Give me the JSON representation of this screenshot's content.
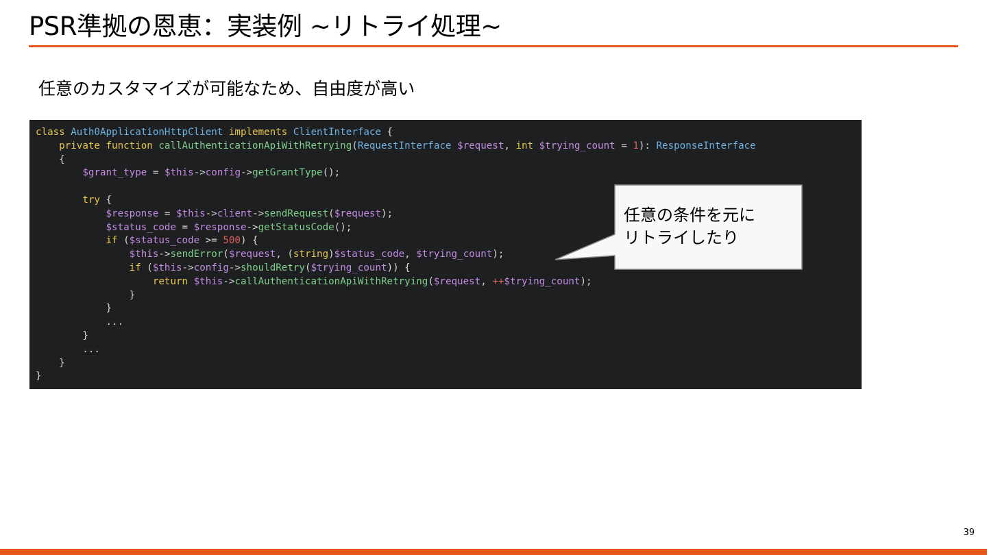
{
  "slide": {
    "title": "PSR準拠の恩恵：実装例 ~リトライ処理~",
    "subtitle": "任意のカスタマイズが可能なため、自由度が高い",
    "page_number": "39"
  },
  "code": {
    "lines": [
      [
        [
          "k",
          "class "
        ],
        [
          "c",
          "Auth0ApplicationHttpClient "
        ],
        [
          "k",
          "implements "
        ],
        [
          "c",
          "ClientInterface "
        ],
        [
          "p",
          "{"
        ]
      ],
      [
        [
          "p",
          "    "
        ],
        [
          "k",
          "private function "
        ],
        [
          "f",
          "callAuthenticationApiWithRetrying"
        ],
        [
          "p",
          "("
        ],
        [
          "c",
          "RequestInterface "
        ],
        [
          "v",
          "$request"
        ],
        [
          "p",
          ", "
        ],
        [
          "k",
          "int "
        ],
        [
          "v",
          "$trying_count "
        ],
        [
          "p",
          "= "
        ],
        [
          "n",
          "1"
        ],
        [
          "p",
          "): "
        ],
        [
          "c",
          "ResponseInterface"
        ]
      ],
      [
        [
          "p",
          "    {"
        ]
      ],
      [
        [
          "p",
          "        "
        ],
        [
          "v",
          "$grant_type "
        ],
        [
          "p",
          "= "
        ],
        [
          "v",
          "$this"
        ],
        [
          "p",
          "->"
        ],
        [
          "v",
          "config"
        ],
        [
          "p",
          "->"
        ],
        [
          "f",
          "getGrantType"
        ],
        [
          "p",
          "();"
        ]
      ],
      [
        [
          "p",
          ""
        ]
      ],
      [
        [
          "p",
          "        "
        ],
        [
          "k",
          "try "
        ],
        [
          "p",
          "{"
        ]
      ],
      [
        [
          "p",
          "            "
        ],
        [
          "v",
          "$response "
        ],
        [
          "p",
          "= "
        ],
        [
          "v",
          "$this"
        ],
        [
          "p",
          "->"
        ],
        [
          "v",
          "client"
        ],
        [
          "p",
          "->"
        ],
        [
          "f",
          "sendRequest"
        ],
        [
          "p",
          "("
        ],
        [
          "v",
          "$request"
        ],
        [
          "p",
          ");"
        ]
      ],
      [
        [
          "p",
          "            "
        ],
        [
          "v",
          "$status_code "
        ],
        [
          "p",
          "= "
        ],
        [
          "v",
          "$response"
        ],
        [
          "p",
          "->"
        ],
        [
          "f",
          "getStatusCode"
        ],
        [
          "p",
          "();"
        ]
      ],
      [
        [
          "p",
          "            "
        ],
        [
          "k",
          "if "
        ],
        [
          "p",
          "("
        ],
        [
          "v",
          "$status_code "
        ],
        [
          "p",
          ">= "
        ],
        [
          "n",
          "500"
        ],
        [
          "p",
          ") {"
        ]
      ],
      [
        [
          "p",
          "                "
        ],
        [
          "v",
          "$this"
        ],
        [
          "p",
          "->"
        ],
        [
          "f",
          "sendError"
        ],
        [
          "p",
          "("
        ],
        [
          "v",
          "$request"
        ],
        [
          "p",
          ", ("
        ],
        [
          "k",
          "string"
        ],
        [
          "p",
          ")"
        ],
        [
          "v",
          "$status_code"
        ],
        [
          "p",
          ", "
        ],
        [
          "v",
          "$trying_count"
        ],
        [
          "p",
          ");"
        ]
      ],
      [
        [
          "p",
          "                "
        ],
        [
          "k",
          "if "
        ],
        [
          "p",
          "("
        ],
        [
          "v",
          "$this"
        ],
        [
          "p",
          "->"
        ],
        [
          "v",
          "config"
        ],
        [
          "p",
          "->"
        ],
        [
          "f",
          "shouldRetry"
        ],
        [
          "p",
          "("
        ],
        [
          "v",
          "$trying_count"
        ],
        [
          "p",
          ")) {"
        ]
      ],
      [
        [
          "p",
          "                    "
        ],
        [
          "k",
          "return "
        ],
        [
          "v",
          "$this"
        ],
        [
          "p",
          "->"
        ],
        [
          "f",
          "callAuthenticationApiWithRetrying"
        ],
        [
          "p",
          "("
        ],
        [
          "v",
          "$request"
        ],
        [
          "p",
          ", "
        ],
        [
          "n",
          "++"
        ],
        [
          "v",
          "$trying_count"
        ],
        [
          "p",
          ");"
        ]
      ],
      [
        [
          "p",
          "                }"
        ]
      ],
      [
        [
          "p",
          "            }"
        ]
      ],
      [
        [
          "p",
          "            ..."
        ]
      ],
      [
        [
          "p",
          "        }"
        ]
      ],
      [
        [
          "p",
          "        ..."
        ]
      ],
      [
        [
          "p",
          "    }"
        ]
      ],
      [
        [
          "p",
          "}"
        ]
      ]
    ]
  },
  "callout": {
    "text": "任意の条件を元に\nリトライしたり"
  },
  "colors": {
    "accent": "#e8561a",
    "code_background": "#1d1f21",
    "keyword": "#e8c64a",
    "class_name": "#6fb3e3",
    "variable": "#c48be3",
    "function": "#7fd08a",
    "number": "#e0605a",
    "punctuation": "#d6d6d6"
  }
}
